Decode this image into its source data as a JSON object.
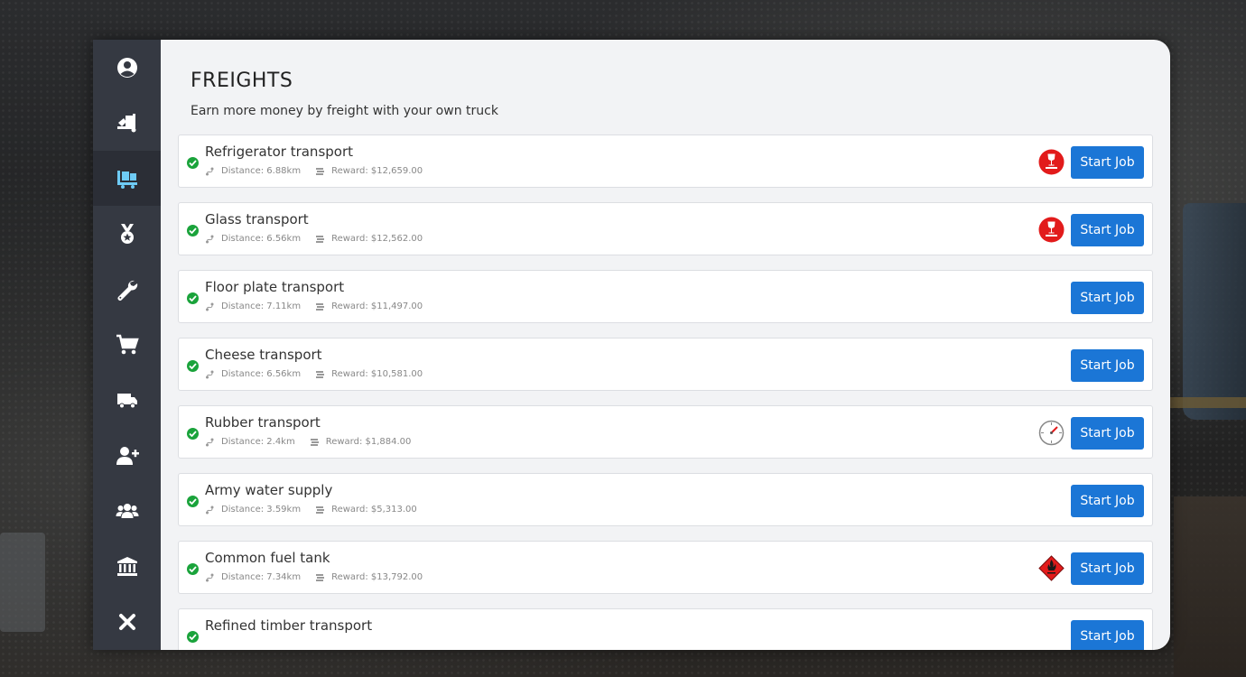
{
  "sidebar": {
    "items": [
      {
        "name": "profile",
        "icon": "user-circle-icon",
        "active": false
      },
      {
        "name": "truck-loading",
        "icon": "truck-loading-icon",
        "active": false
      },
      {
        "name": "freights",
        "icon": "pallet-boxes-icon",
        "active": true
      },
      {
        "name": "achievements",
        "icon": "medal-icon",
        "active": false
      },
      {
        "name": "upgrades",
        "icon": "wrench-icon",
        "active": false
      },
      {
        "name": "shop",
        "icon": "shopping-cart-icon",
        "active": false
      },
      {
        "name": "trucks",
        "icon": "truck-icon",
        "active": false
      },
      {
        "name": "hire",
        "icon": "user-plus-icon",
        "active": false
      },
      {
        "name": "employees",
        "icon": "users-icon",
        "active": false
      },
      {
        "name": "bank",
        "icon": "bank-icon",
        "active": false
      },
      {
        "name": "close",
        "icon": "close-icon",
        "active": false
      }
    ]
  },
  "header": {
    "title": "FREIGHTS",
    "subtitle": "Earn more money by freight with your own truck"
  },
  "labels": {
    "distance_prefix": "Distance: ",
    "reward_prefix": "Reward: ",
    "start_button": "Start Job"
  },
  "freights": [
    {
      "title": "Refrigerator transport",
      "distance": "Distance: 6.88km",
      "reward": "Reward: $12,659.00",
      "badge": "fragile",
      "button": "Start Job"
    },
    {
      "title": "Glass transport",
      "distance": "Distance: 6.56km",
      "reward": "Reward: $12,562.00",
      "badge": "fragile",
      "button": "Start Job"
    },
    {
      "title": "Floor plate transport",
      "distance": "Distance: 7.11km",
      "reward": "Reward: $11,497.00",
      "badge": "",
      "button": "Start Job"
    },
    {
      "title": "Cheese transport",
      "distance": "Distance: 6.56km",
      "reward": "Reward: $10,581.00",
      "badge": "",
      "button": "Start Job"
    },
    {
      "title": "Rubber transport",
      "distance": "Distance: 2.4km",
      "reward": "Reward: $1,884.00",
      "badge": "urgent",
      "button": "Start Job"
    },
    {
      "title": "Army water supply",
      "distance": "Distance: 3.59km",
      "reward": "Reward: $5,313.00",
      "badge": "",
      "button": "Start Job"
    },
    {
      "title": "Common fuel tank",
      "distance": "Distance: 7.34km",
      "reward": "Reward: $13,792.00",
      "badge": "flammable",
      "button": "Start Job"
    },
    {
      "title": "Refined timber transport",
      "distance": "",
      "reward": "",
      "badge": "",
      "button": "Start Job"
    }
  ],
  "colors": {
    "sidebar_bg": "#353942",
    "sidebar_active": "#6ecbf5",
    "button": "#1b76d6",
    "check": "#1aa33b",
    "badge_red": "#e21b1b"
  }
}
